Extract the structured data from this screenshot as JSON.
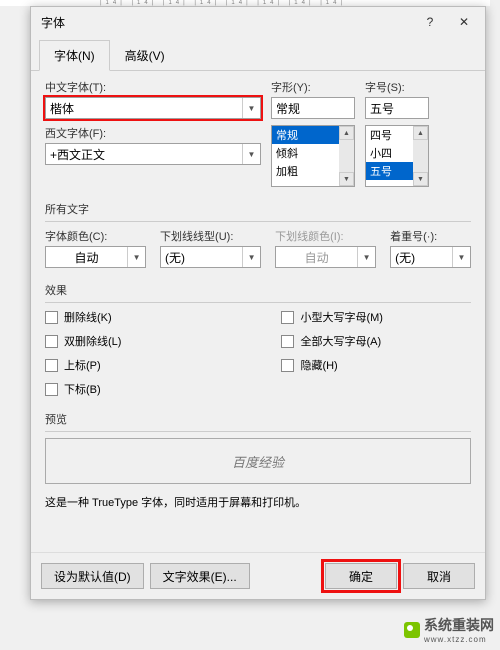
{
  "ruler_text": "|14| |14| |14| |14| |14| |14| |14| |14|",
  "dialog": {
    "title": "字体",
    "help": "?",
    "close": "✕"
  },
  "tabs": {
    "font": "字体(N)",
    "advanced": "高级(V)"
  },
  "cn_font": {
    "label": "中文字体(T):",
    "value": "楷体"
  },
  "western_font": {
    "label": "西文字体(F):",
    "value": "+西文正文"
  },
  "style": {
    "label": "字形(Y):",
    "value": "常规",
    "options": [
      "常规",
      "倾斜",
      "加粗"
    ]
  },
  "size": {
    "label": "字号(S):",
    "value": "五号",
    "options": [
      "四号",
      "小四",
      "五号"
    ]
  },
  "all_text": "所有文字",
  "font_color": {
    "label": "字体颜色(C):",
    "value": "自动"
  },
  "underline": {
    "label": "下划线线型(U):",
    "value": "(无)"
  },
  "underline_color": {
    "label": "下划线颜色(I):",
    "value": "自动"
  },
  "emphasis": {
    "label": "着重号(·):",
    "value": "(无)"
  },
  "effects": "效果",
  "checks_left": [
    "删除线(K)",
    "双删除线(L)",
    "上标(P)",
    "下标(B)"
  ],
  "checks_right": [
    "小型大写字母(M)",
    "全部大写字母(A)",
    "隐藏(H)"
  ],
  "preview": {
    "label": "预览",
    "sample": "百度经验"
  },
  "description": "这是一种 TrueType 字体，同时适用于屏幕和打印机。",
  "footer": {
    "default": "设为默认值(D)",
    "text_effect": "文字效果(E)...",
    "ok": "确定",
    "cancel": "取消"
  },
  "watermark": "系统重装网",
  "watermark_url": "www.xtzz.com"
}
